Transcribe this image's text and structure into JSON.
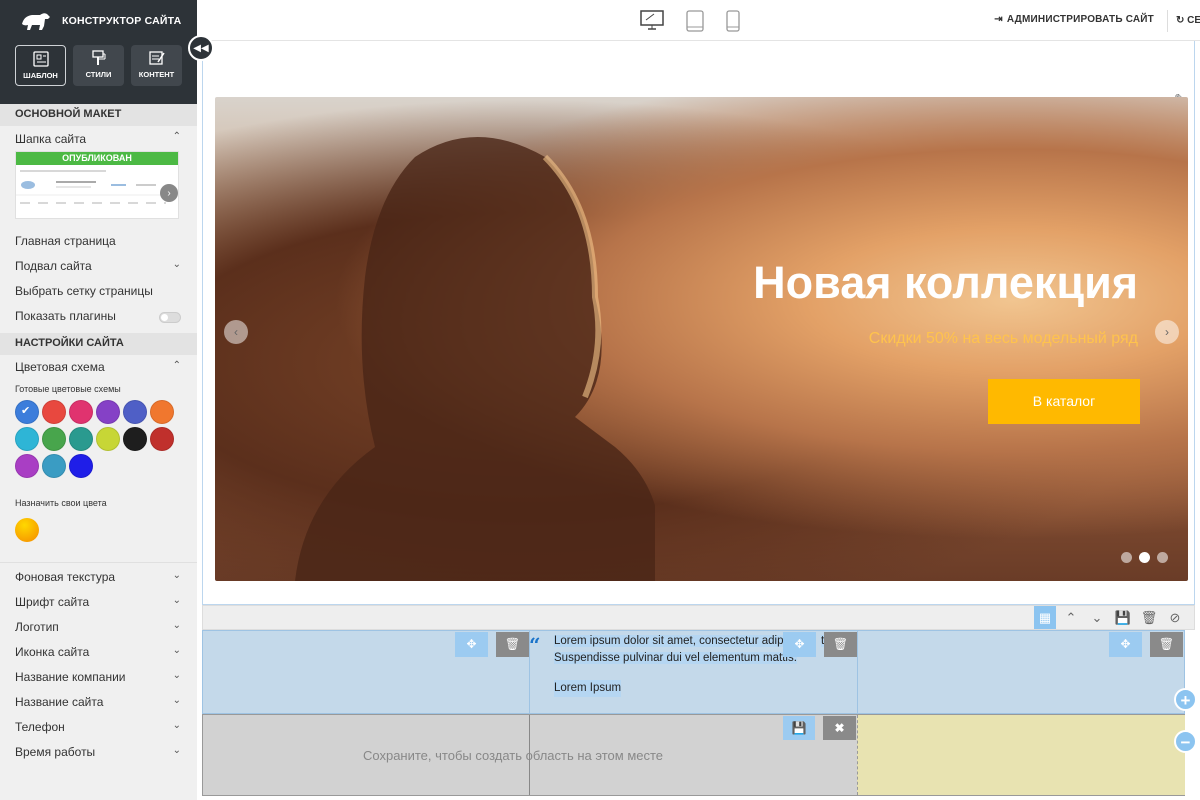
{
  "sidebar": {
    "brand": "КОНСТРУКТОР САЙТА",
    "modes": [
      {
        "label": "ШАБЛОН",
        "icon": "template-icon",
        "active": true
      },
      {
        "label": "СТИЛИ",
        "icon": "styles-icon",
        "active": false
      },
      {
        "label": "КОНТЕНТ",
        "icon": "content-icon",
        "active": false
      }
    ],
    "section_layout": "ОСНОВНОЙ МАКЕТ",
    "header_item": "Шапка сайта",
    "published_badge": "ОПУБЛИКОВАН",
    "items_layout": [
      {
        "label": "Главная страница",
        "chevron": false
      },
      {
        "label": "Подвал сайта",
        "chevron": true
      },
      {
        "label": "Выбрать сетку страницы",
        "chevron": false
      },
      {
        "label": "Показать плагины",
        "chevron": false,
        "toggle": true
      }
    ],
    "section_settings": "НАСТРОЙКИ САЙТА",
    "color_scheme": "Цветовая схема",
    "ready_schemes": "Готовые цветовые схемы",
    "swatches": [
      "#3c7ddb",
      "#e8483f",
      "#e0336f",
      "#8541c6",
      "#4f5fc6",
      "#f0772e",
      "#2eb5d6",
      "#48a54c",
      "#2a9a8f",
      "#c7d636",
      "#1e1e1e",
      "#c0302c",
      "#a93ec4",
      "#3a9cc3",
      "#1f1ee8"
    ],
    "custom_colors": "Назначить свои цвета",
    "items_settings": [
      "Фоновая текстура",
      "Шрифт сайта",
      "Логотип",
      "Иконка сайта",
      "Название компании",
      "Название сайта",
      "Телефон",
      "Время работы"
    ]
  },
  "topbar": {
    "admin_label": "АДМИНИСТРИРОВАТЬ САЙТ",
    "refresh_label": "СЕ"
  },
  "slider": {
    "title": "Новая коллекция",
    "subtitle": "Скидки 50% на весь модельный ряд",
    "button": "В каталог",
    "current_slide": 2,
    "slide_count": 3
  },
  "content": {
    "paragraph": "Lorem ipsum dolor sit amet, consectetur adipis t. Suspendisse pulvinar dui vel elementum mattis.",
    "paragraph_line1": "Lorem ipsum dolor sit amet, consectetur adipis",
    "paragraph_tail": "t.",
    "paragraph_line2": "Suspendisse pulvinar dui vel elementum mattis.",
    "caption": "Lorem Ipsum",
    "save_message": "Сохраните, чтобы создать область на этом месте"
  }
}
